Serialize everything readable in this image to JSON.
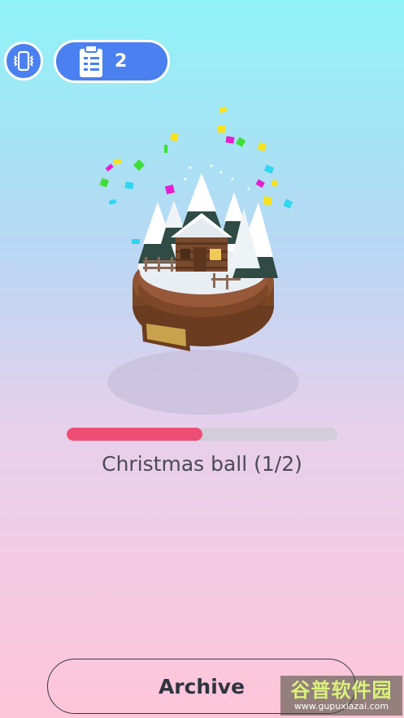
{
  "toolbar": {
    "vibration_icon": "phone-vibrate-icon",
    "tasks_icon": "clipboard-checklist-icon",
    "tasks_count": "2"
  },
  "level": {
    "title": "Christmas ball (1/2)",
    "progress": 0.5
  },
  "buttons": {
    "archive_label": "Archive"
  },
  "watermark": {
    "main": "谷普软件园",
    "sub": "www.gupuxiazai.com"
  },
  "colors": {
    "accent_blue": "#4a80f0",
    "progress_fill": "#ef4e74",
    "progress_track": "#d3ccd9",
    "text": "#4a4a57"
  }
}
